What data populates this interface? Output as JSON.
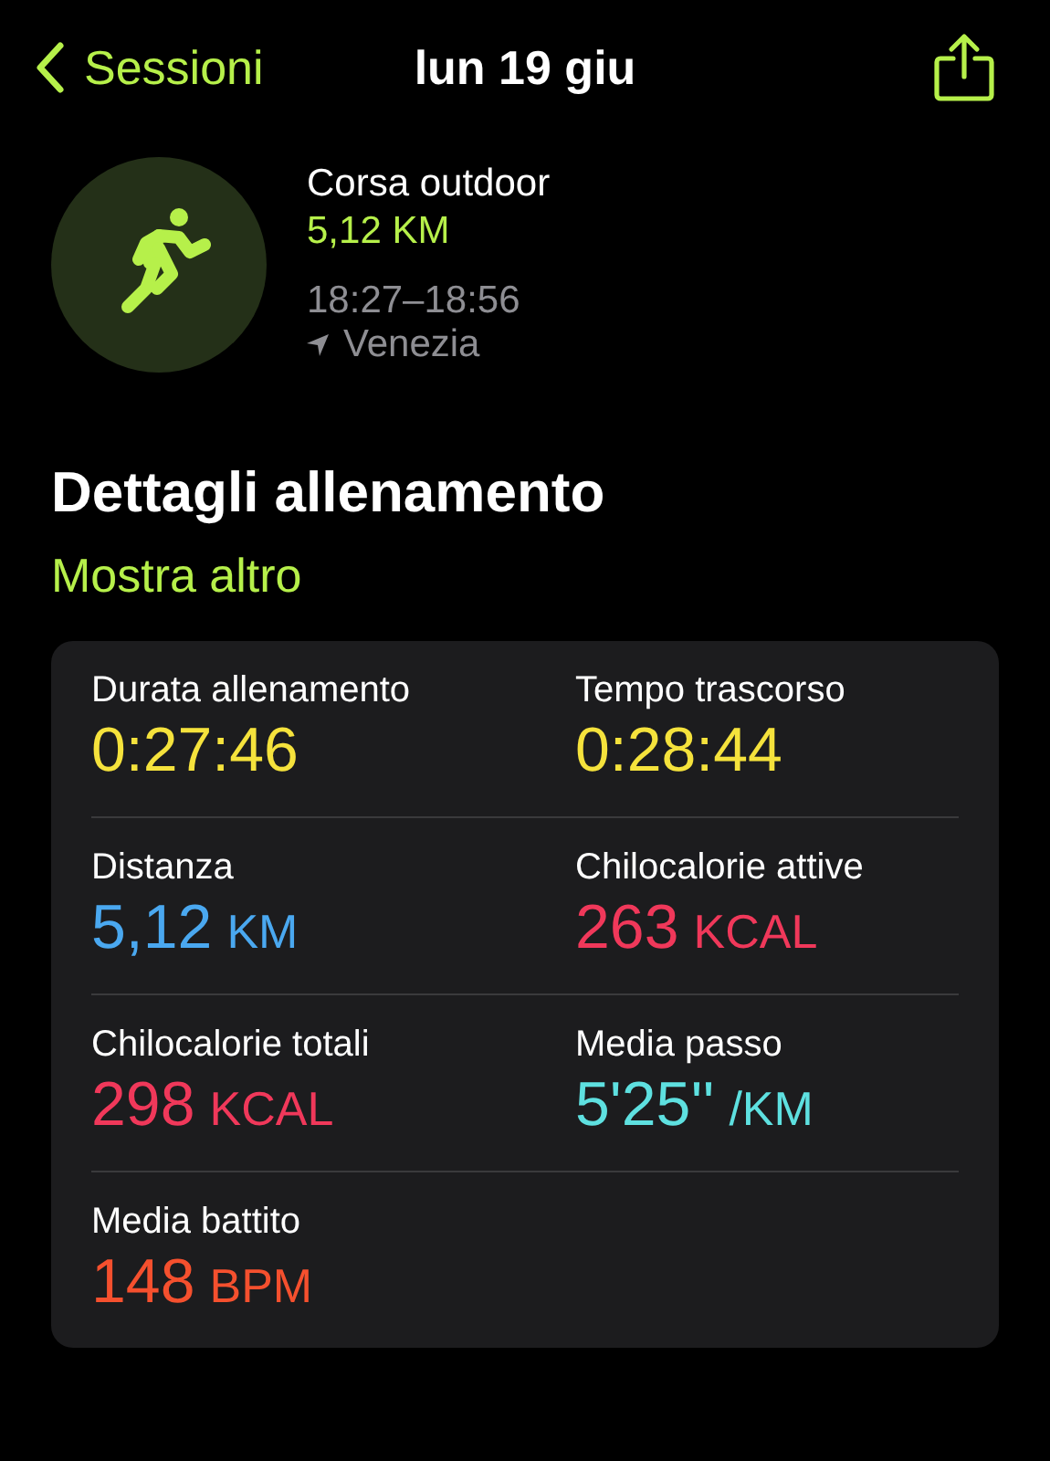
{
  "nav": {
    "back_label": "Sessioni",
    "title": "lun 19 giu"
  },
  "workout": {
    "name": "Corsa outdoor",
    "distance": "5,12 KM",
    "time_range": "18:27–18:56",
    "location": "Venezia"
  },
  "section": {
    "title": "Dettagli allenamento",
    "link": "Mostra altro"
  },
  "metrics": [
    {
      "label": "Durata allenamento",
      "value": "0:27:46",
      "color": "#f5e23c"
    },
    {
      "label": "Tempo trascorso",
      "value": "0:28:44",
      "color": "#f5e23c"
    },
    {
      "label": "Distanza",
      "value": "5,12",
      "unit": "KM",
      "color": "#4aa8f0"
    },
    {
      "label": "Chilocalorie attive",
      "value": "263",
      "unit": "KCAL",
      "color": "#f0385a"
    },
    {
      "label": "Chilocalorie totali",
      "value": "298",
      "unit": "KCAL",
      "color": "#f0385a"
    },
    {
      "label": "Media passo",
      "value": "5'25''",
      "unit": "/KM",
      "color": "#5ee0e0"
    },
    {
      "label": "Media battito",
      "value": "148",
      "unit": "BPM",
      "color": "#f5502e"
    }
  ]
}
